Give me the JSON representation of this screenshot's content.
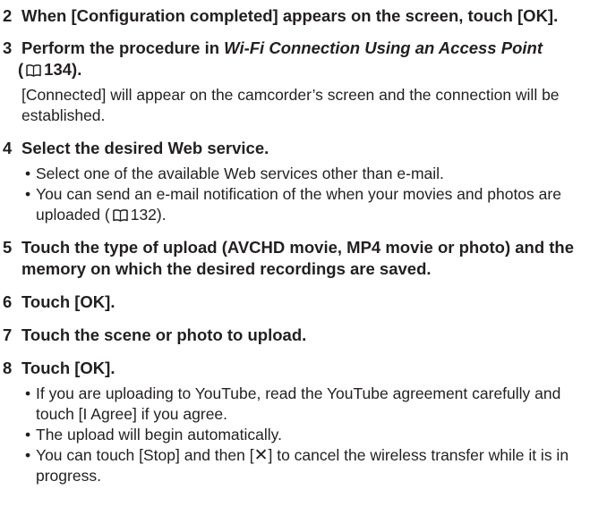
{
  "steps": [
    {
      "num": "2",
      "title": "When [Configuration completed] appears on the screen, touch [OK]."
    },
    {
      "num": "3",
      "title_prefix": "Perform the procedure in ",
      "title_italic": "Wi-Fi Connection Using an Access Point",
      "title_open": " (",
      "title_ref": "134",
      "title_close": ").",
      "body": "[Connected] will appear on the camcorder’s screen and the connection will be established."
    },
    {
      "num": "4",
      "title": "Select the desired Web service.",
      "bullets": [
        "Select one of the available Web services other than e-mail.",
        {
          "before": "You can send an e-mail notification of the when your movies and photos are uploaded (",
          "ref": "132",
          "after": ")."
        }
      ]
    },
    {
      "num": "5",
      "title": "Touch the type of upload (AVCHD movie, MP4 movie or photo) and the memory on which the desired recordings are saved."
    },
    {
      "num": "6",
      "title": "Touch [OK]."
    },
    {
      "num": "7",
      "title": "Touch the scene or photo to upload."
    },
    {
      "num": "8",
      "title": "Touch [OK].",
      "bullets": [
        "If you are uploading to YouTube, read the YouTube agreement carefully and touch [I Agree] if you agree.",
        "The upload will begin automatically.",
        {
          "before": "You can touch [Stop] and then [",
          "mark": "✕",
          "after": "] to cancel the wireless transfer while it is in progress."
        }
      ]
    }
  ],
  "bullet_glyph": "•",
  "icons": {
    "reference": "book-reference-icon"
  }
}
